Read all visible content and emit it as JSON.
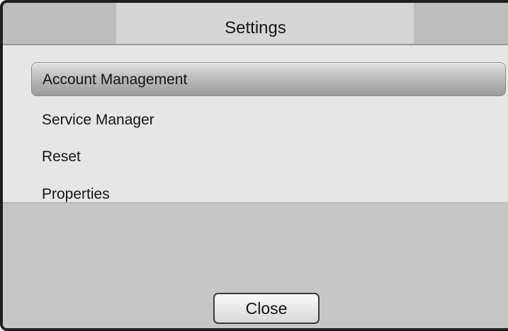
{
  "dialog": {
    "title": "Settings"
  },
  "menu": {
    "items": [
      {
        "label": "Account Management",
        "selected": true
      },
      {
        "label": "Service Manager",
        "selected": false
      },
      {
        "label": "Reset",
        "selected": false
      },
      {
        "label": "Properties",
        "selected": false
      }
    ]
  },
  "footer": {
    "close_label": "Close"
  }
}
